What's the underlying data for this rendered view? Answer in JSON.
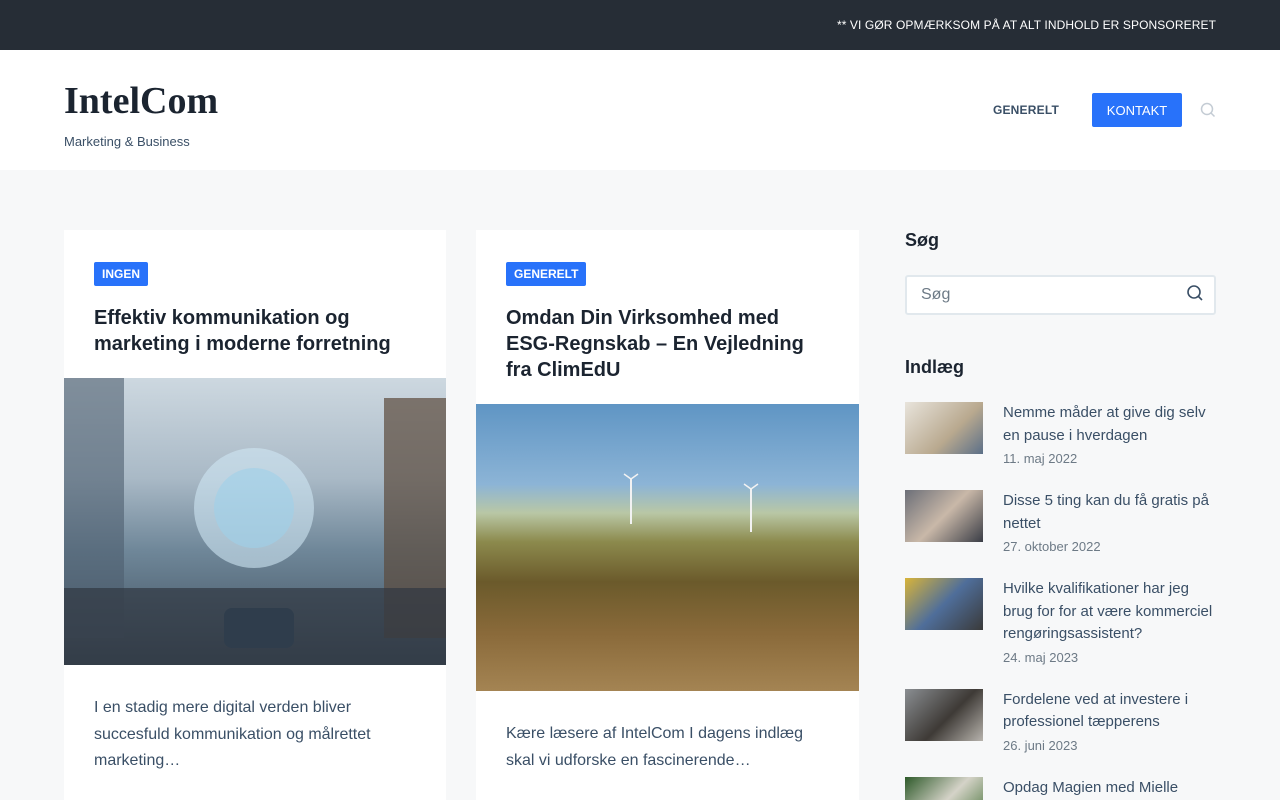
{
  "topbar": {
    "notice": "** VI GØR OPMÆRKSOM PÅ AT ALT INDHOLD ER SPONSORERET"
  },
  "header": {
    "site_title": "IntelCom",
    "tagline": "Marketing & Business",
    "nav": [
      {
        "label": "GENERELT"
      },
      {
        "label": "KONTAKT"
      }
    ]
  },
  "posts": [
    {
      "category": "INGEN",
      "title": "Effektiv kommunikation og marketing i moderne forretning",
      "excerpt": "I en stadig mere digital verden bliver succesfuld kommunikation og målrettet marketing…"
    },
    {
      "category": "GENERELT",
      "title": "Omdan Din Virksomhed med ESG-Regnskab – En Vejledning fra ClimEdU",
      "excerpt": "Kære læsere af IntelCom I dagens indlæg skal vi udforske en fascinerende…"
    }
  ],
  "sidebar": {
    "search_heading": "Søg",
    "search_placeholder": "Søg",
    "posts_heading": "Indlæg",
    "recent": [
      {
        "title": "Nemme måder at give dig selv en pause i hverdagen",
        "date": "11. maj 2022"
      },
      {
        "title": "Disse 5 ting kan du få gratis på nettet",
        "date": "27. oktober 2022"
      },
      {
        "title": "Hvilke kvalifikationer har jeg brug for for at være kommerciel rengøringsassistent?",
        "date": "24. maj 2023"
      },
      {
        "title": "Fordelene ved at investere i professionel tæpperens",
        "date": "26. juni 2023"
      },
      {
        "title": "Opdag Magien med Mielle Rosemary Mint Scalp: En",
        "date": ""
      }
    ]
  },
  "colors": {
    "accent": "#2872fa",
    "topbar": "#262d36",
    "heading": "#1b2430",
    "text": "#3a4f66"
  }
}
